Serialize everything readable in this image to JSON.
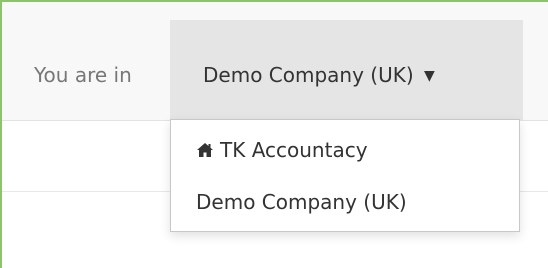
{
  "context": {
    "label": "You are in"
  },
  "company_switcher": {
    "current": "Demo Company (UK)",
    "caret": "▼",
    "items": [
      {
        "label": "TK Accountacy",
        "icon": "home-icon"
      },
      {
        "label": "Demo Company (UK)",
        "icon": ""
      }
    ]
  }
}
